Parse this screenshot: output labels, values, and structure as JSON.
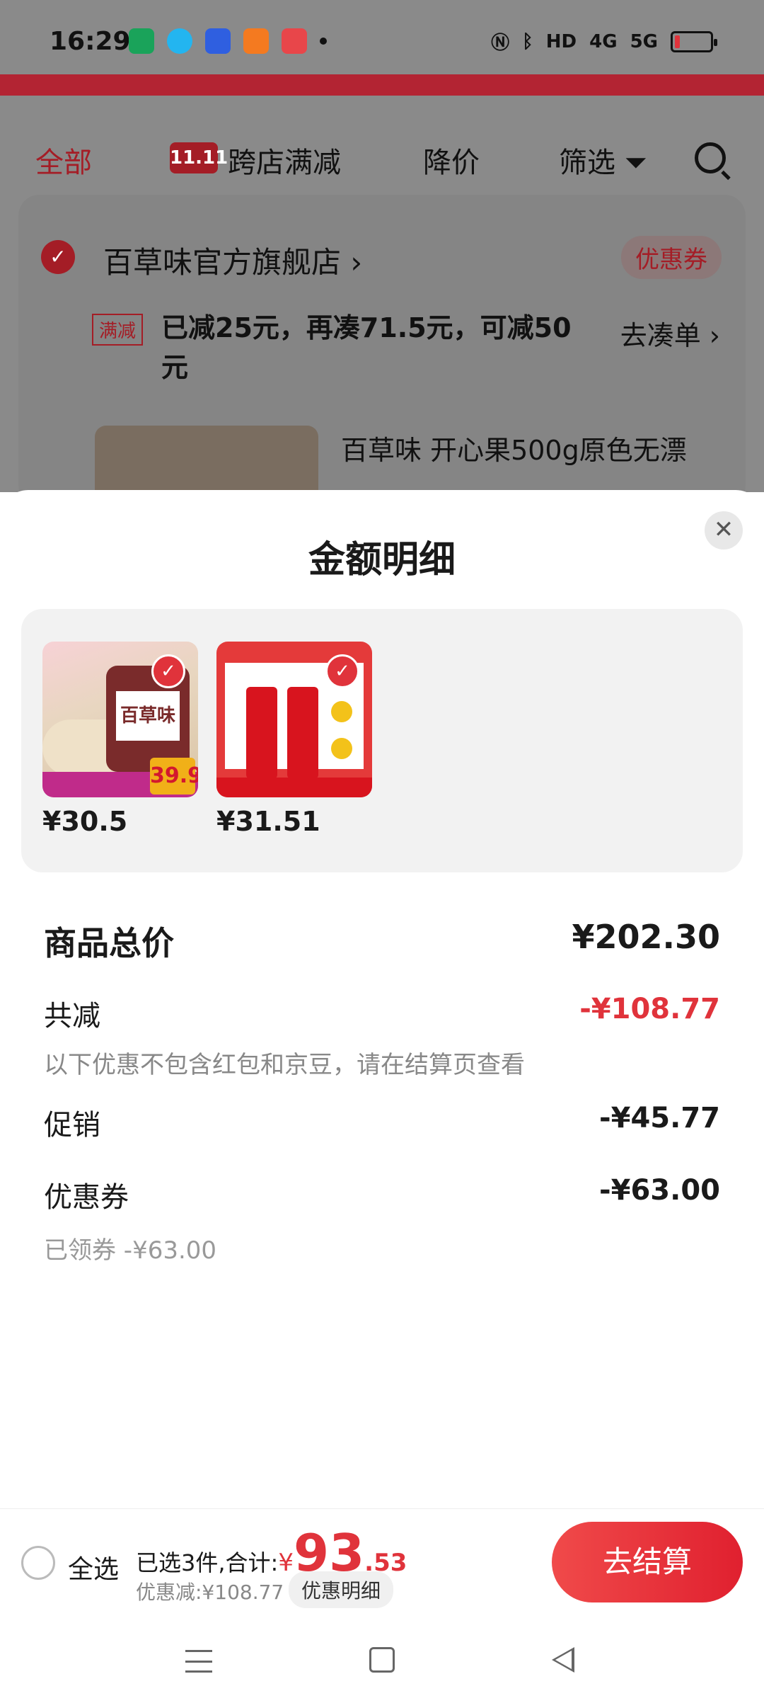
{
  "status_bar": {
    "time": "16:29",
    "icons": [
      "oppo-app-icon",
      "qq-icon",
      "baidu-icon",
      "kuaishou-icon",
      "double11-app-icon"
    ],
    "right": [
      "nfc-icon",
      "bluetooth-icon",
      "hd-icon",
      "4g-signal-icon",
      "5g-signal-icon",
      "battery-icon"
    ],
    "hd_label": "HD",
    "signal_4g": "4G",
    "signal_5g": "5G",
    "battery_level": 0.15
  },
  "background_page": {
    "filters": {
      "all": "全部",
      "badge": "11.11",
      "cross_store": "跨店满减",
      "price_drop": "降价",
      "filter": "筛选"
    },
    "store": {
      "name": "百草味官方旗舰店",
      "coupon": "优惠券",
      "promo_tag": "满减",
      "promo_text": "已减25元，再凑71.5元，可减50元",
      "go_add": "去凑单",
      "product_title": "百草味 开心果500g原色无漂"
    }
  },
  "sheet": {
    "title": "金额明细",
    "items": [
      {
        "price": "¥30.5",
        "jar_label": "百草味",
        "badge_price": "39.9"
      },
      {
        "price": "¥31.51"
      }
    ],
    "total_label": "商品总价",
    "total_value": "¥202.30",
    "reduce_label": "共减",
    "reduce_value": "-¥108.77",
    "reduce_note": "以下优惠不包含红包和京豆，请在结算页查看",
    "promo_label": "促销",
    "promo_value": "-¥45.77",
    "coupon_label": "优惠券",
    "coupon_value": "-¥63.00",
    "coupon_note": "已领券 -¥63.00"
  },
  "checkout": {
    "select_all": "全选",
    "summary_prefix": "已选3件,合计:",
    "yen": "¥",
    "total_int": "93",
    "total_dec": ".53",
    "saved": "优惠减:¥108.77",
    "detail": "优惠明细",
    "checkout_btn": "去结算"
  },
  "colors": {
    "accent": "#e0333b",
    "brand_red": "#a41d26"
  }
}
